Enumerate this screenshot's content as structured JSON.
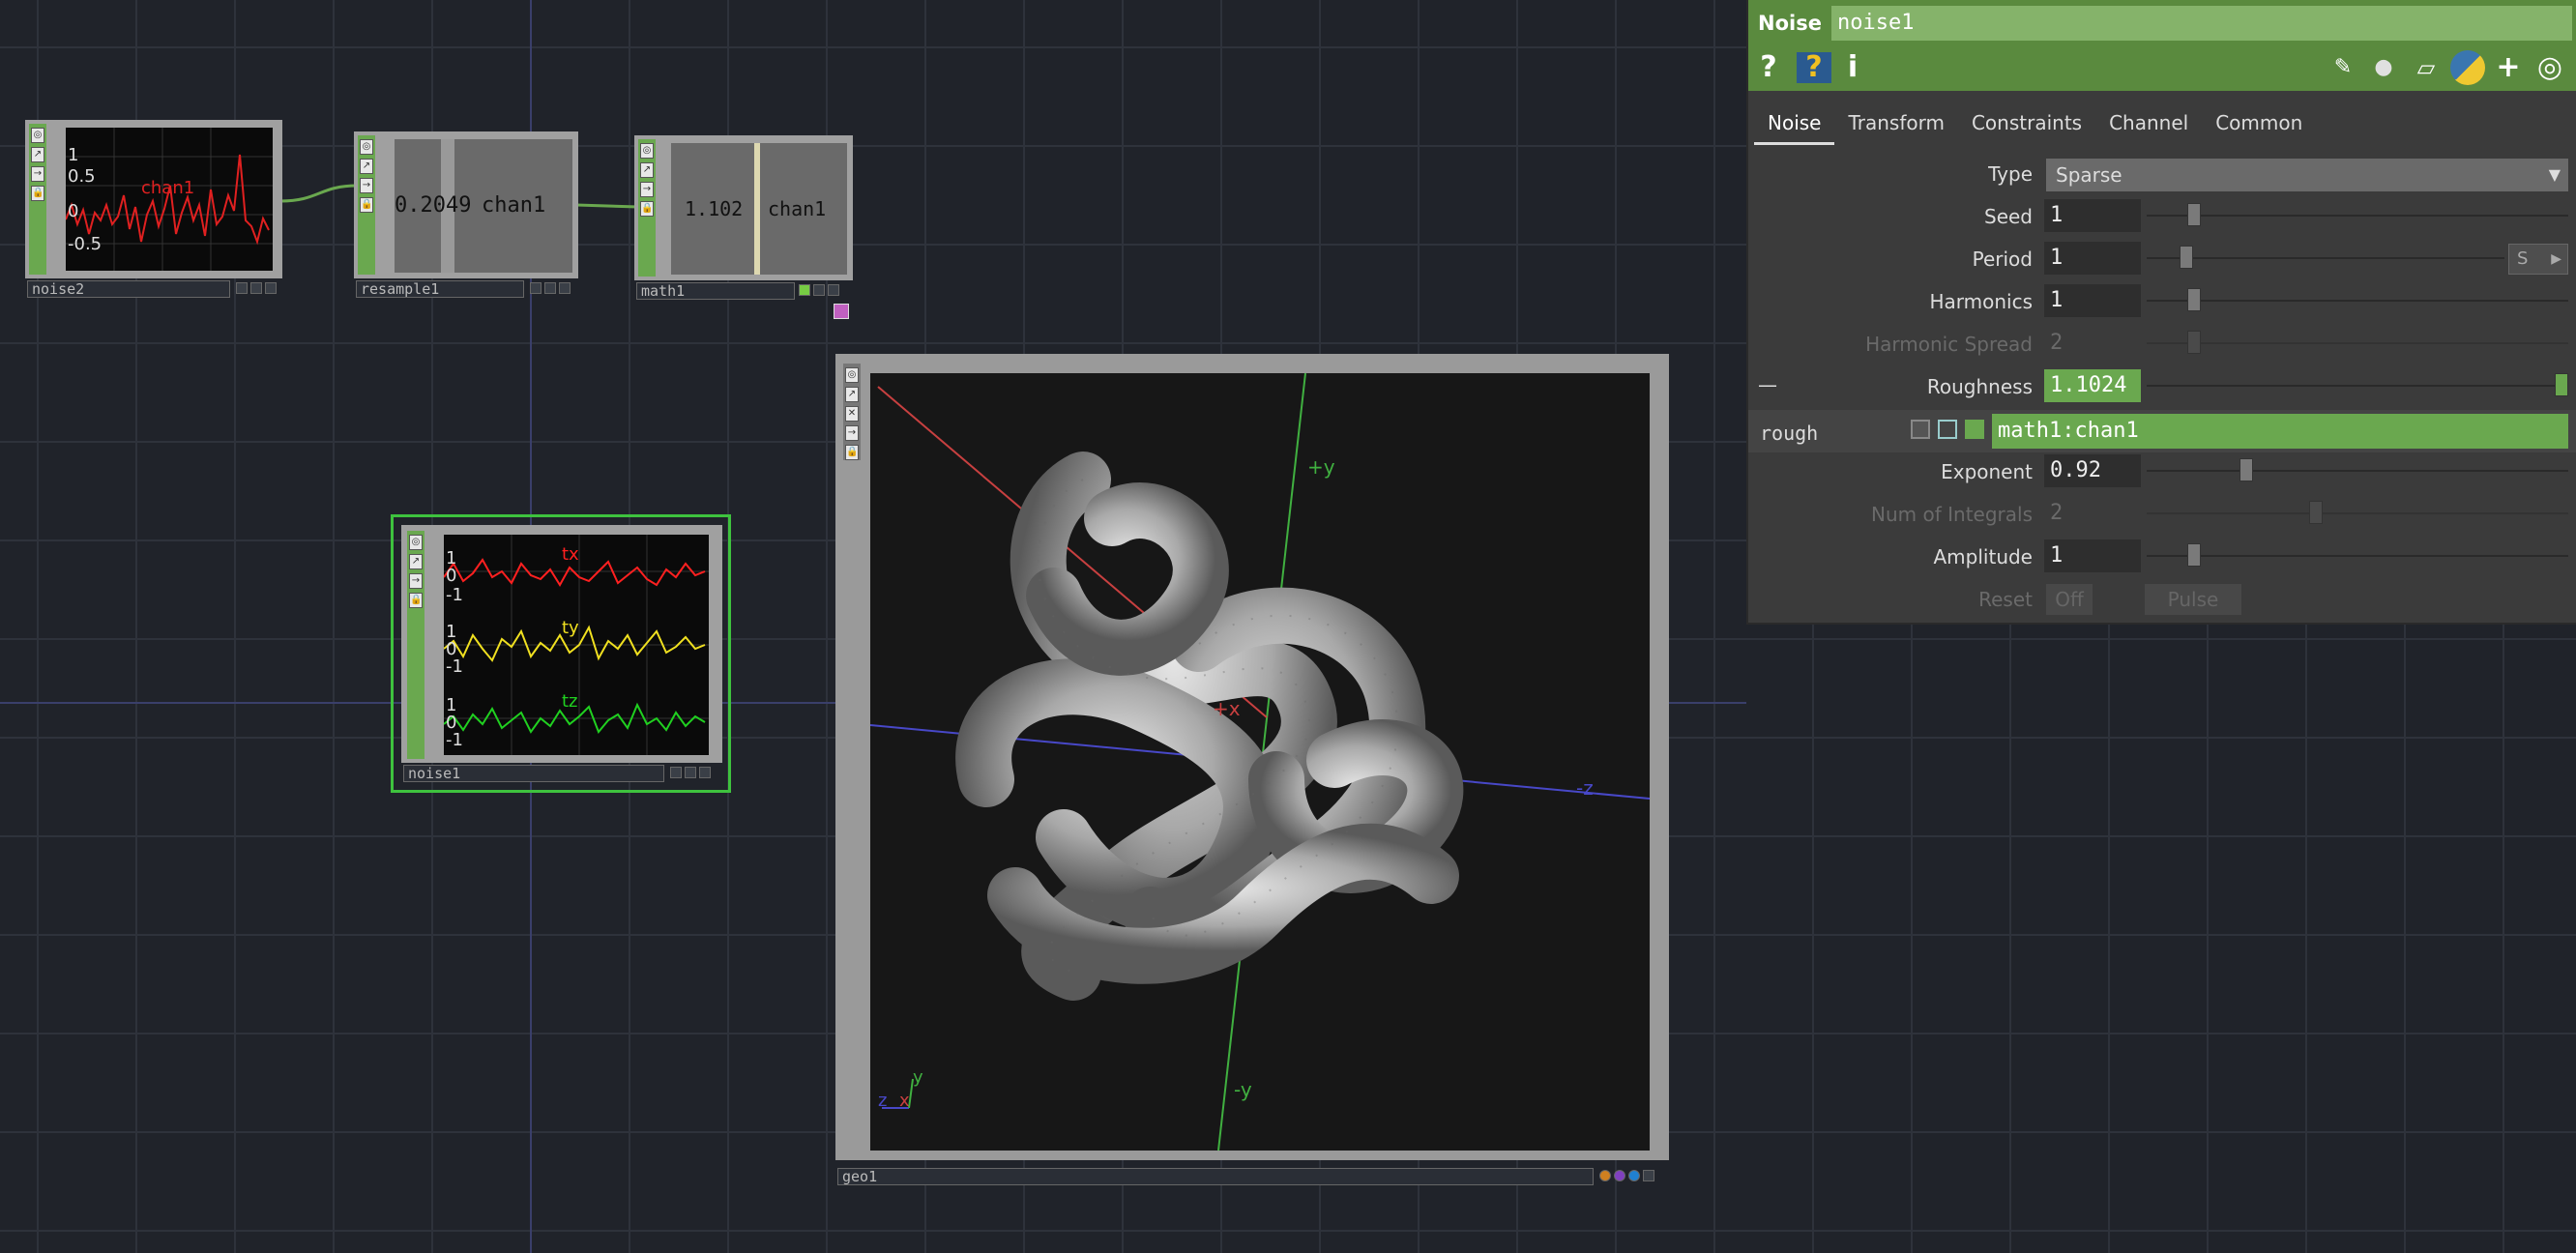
{
  "network": {
    "nodes": {
      "noise2": {
        "name": "noise2",
        "chart_labels": [
          "1",
          "0.5",
          "0",
          "-0.5"
        ],
        "channel": "chan1"
      },
      "resample1": {
        "name": "resample1",
        "value": "0.2049",
        "channel": "chan1"
      },
      "math1": {
        "name": "math1",
        "value": "1.102",
        "channel": "chan1"
      },
      "noise1": {
        "name": "noise1",
        "channels": [
          {
            "name": "tx",
            "color": "#ff2020",
            "labels": [
              "1",
              "0",
              "-1"
            ]
          },
          {
            "name": "ty",
            "color": "#f0e020",
            "labels": [
              "1",
              "0",
              "-1"
            ]
          },
          {
            "name": "tz",
            "color": "#20d020",
            "labels": [
              "1",
              "0",
              "-1"
            ]
          }
        ]
      },
      "geo1": {
        "name": "geo1",
        "axes": {
          "pos_y": "+y",
          "neg_y": "-y",
          "pos_x": "+x",
          "neg_z": "-z"
        },
        "gizmo": {
          "y": "y",
          "z": "z",
          "x": "x"
        }
      }
    }
  },
  "panel": {
    "op_type": "Noise",
    "op_name": "noise1",
    "toolbar": [
      "?",
      "?",
      "i"
    ],
    "tabs": [
      "Noise",
      "Transform",
      "Constraints",
      "Channel",
      "Common"
    ],
    "params": {
      "type": {
        "label": "Type",
        "value": "Sparse"
      },
      "seed": {
        "label": "Seed",
        "value": "1"
      },
      "period": {
        "label": "Period",
        "value": "1",
        "unit": "S"
      },
      "harmonics": {
        "label": "Harmonics",
        "value": "1"
      },
      "harmonic_spread": {
        "label": "Harmonic Spread",
        "value": "2"
      },
      "roughness": {
        "label": "Roughness",
        "value": "1.1024",
        "collapse": "—"
      },
      "rough_expr": {
        "label": "rough",
        "value": "math1:chan1"
      },
      "exponent": {
        "label": "Exponent",
        "value": "0.92"
      },
      "num_integrals": {
        "label": "Num of Integrals",
        "value": "2"
      },
      "amplitude": {
        "label": "Amplitude",
        "value": "1"
      },
      "reset": {
        "label": "Reset",
        "value": "Off",
        "pulse": "Pulse"
      }
    }
  }
}
